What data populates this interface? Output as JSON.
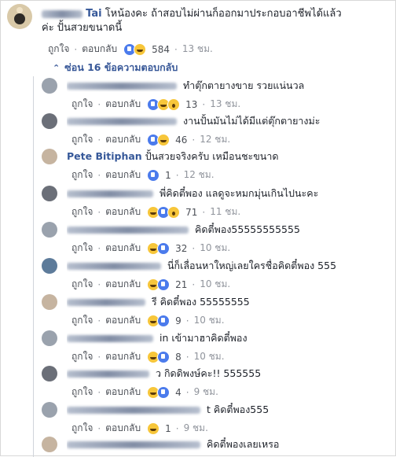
{
  "root_comment": {
    "author_visible_suffix": "Tai",
    "text_line1": "โหน้องคะ ถ้าสอบไม่ผ่านก็ออกมาประกอบอาชีพได้แล้ว",
    "text_line2": "ค่ะ ปั้นสวยขนาดนี้",
    "like_label": "ถูกใจ",
    "reply_label": "ตอบกลับ",
    "reaction_count": "584",
    "time": "13 ชม."
  },
  "hide_replies_label": "ซ่อน 16 ข้อความตอบกลับ",
  "reply_actions": {
    "like_label": "ถูกใจ",
    "reply_label": "ตอบกลับ"
  },
  "replies": [
    {
      "author": "",
      "text": "ทำตุ๊กตายางขาย รวยแน่นวล",
      "count": "13",
      "time": "13 ชม."
    },
    {
      "author": "",
      "text": "งานปั้นมันไม่ได้มีแต่ตุ๊กตายางม่ะ",
      "count": "46",
      "time": "12 ชม."
    },
    {
      "author": "Pete Bitiphan",
      "text": "ปั้นสวยจริงครับ เหมือนชะขนาด",
      "count": "1",
      "time": "12 ชม."
    },
    {
      "author": "",
      "text": "พี่คิดตี๋พอง แลดูจะหมกมุ่นเกินไปนะคะ",
      "count": "71",
      "time": "11 ชม."
    },
    {
      "author": "",
      "text": "คิดตี๋พอง55555555555",
      "count": "32",
      "time": "10 ชม."
    },
    {
      "author": "",
      "text": "นี่ก็เลื่อนหาใหญ่เลยใครชื่อคิดตี๋พอง 555",
      "count": "21",
      "time": "10 ชม."
    },
    {
      "author": "",
      "text": "รี คิดตี๋พอง 55555555",
      "count": "9",
      "time": "10 ชม."
    },
    {
      "author": "",
      "text": "in เข้ามาฮาคิดตี๋พอง",
      "count": "8",
      "time": "10 ชม."
    },
    {
      "author": "",
      "text": "ว กิดดิพงษ์คะ!! 555555",
      "count": "4",
      "time": "9 ชม."
    },
    {
      "author": "",
      "text": "t คิดตี๋พอง555",
      "count": "1",
      "time": "9 ชม."
    },
    {
      "author": "",
      "text": "คิดตี๋พองเลยเหรอ",
      "count": "",
      "time": ""
    }
  ],
  "colors": {
    "link": "#385898",
    "meta": "#90949c",
    "thread_line": "#d0d4da"
  },
  "icons": [
    "like-icon",
    "haha-icon",
    "wow-icon",
    "love-icon"
  ]
}
